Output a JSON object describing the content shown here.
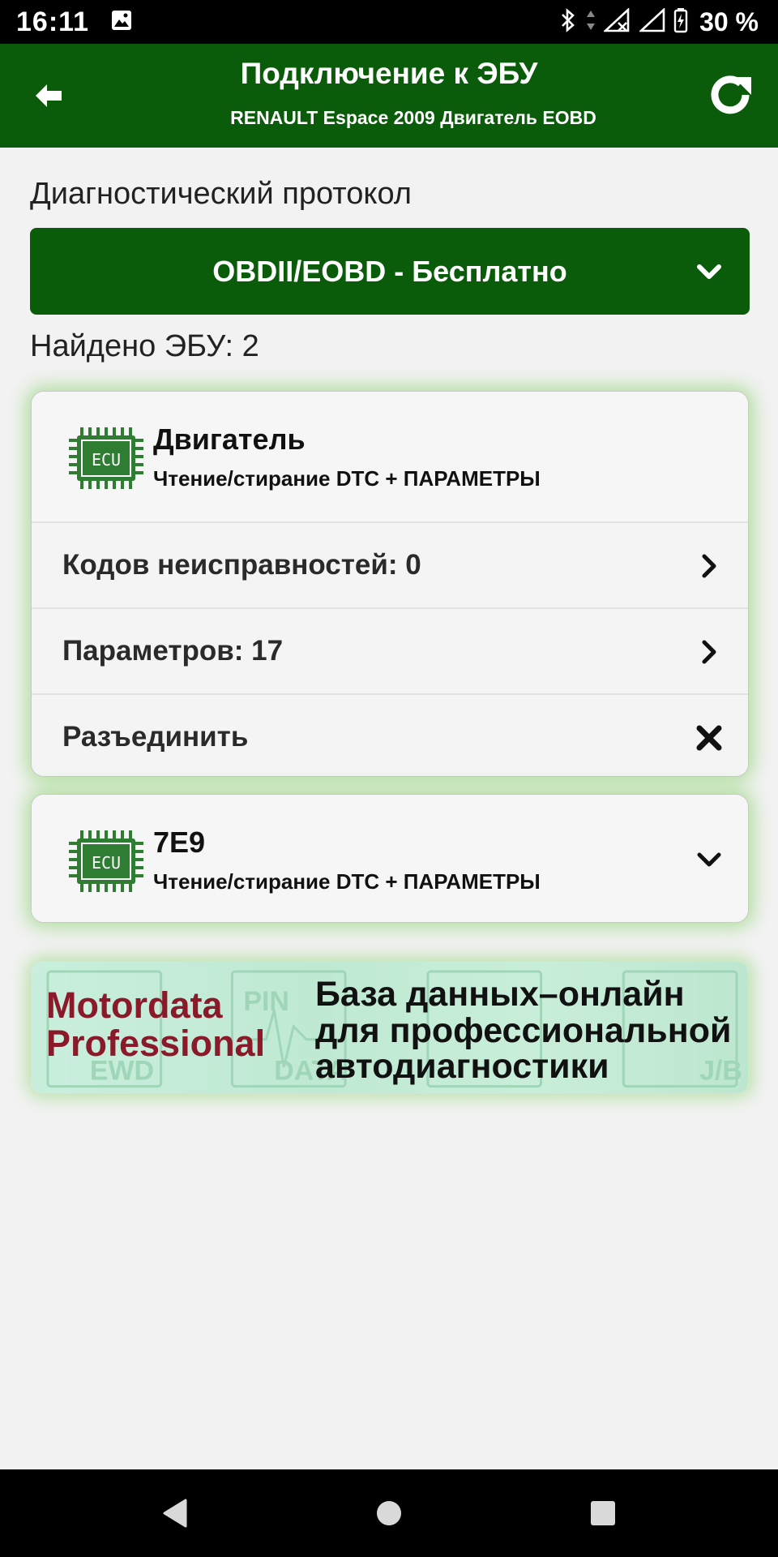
{
  "status": {
    "time": "16:11",
    "battery": "30 %"
  },
  "appbar": {
    "title": "Подключение к ЭБУ",
    "subtitle": "RENAULT Espace 2009 Двигатель EOBD"
  },
  "protocol": {
    "label": "Диагностический протокол",
    "selected": "OBDII/EOBD - Бесплатно"
  },
  "found": "Найдено ЭБУ: 2",
  "ecus": [
    {
      "title": "Двигатель",
      "subtitle": "Чтение/стирание DTC + ПАРАМЕТРЫ",
      "icon_text": "ECU",
      "rows": [
        {
          "label": "Кодов неисправностей: 0",
          "icon": "chevron-right-icon"
        },
        {
          "label": "Параметров: 17",
          "icon": "chevron-right-icon"
        },
        {
          "label": "Разъединить",
          "icon": "close-icon"
        }
      ]
    },
    {
      "title": "7E9",
      "subtitle": "Чтение/стирание DTC + ПАРАМЕТРЫ",
      "icon_text": "ECU"
    }
  ],
  "banner": {
    "brand_line1": "Motordata",
    "brand_line2": "Professional",
    "tagline_line1": "База данных–онлайн",
    "tagline_line2": "для профессиональной",
    "tagline_line3": "автодиагностики",
    "watermarks": [
      "EWD",
      "PIN",
      "DATA",
      "J/B"
    ]
  },
  "colors": {
    "primary": "#0a5c0a",
    "icon_green": "#2e7d32",
    "brand_red": "#8a1a2a"
  }
}
